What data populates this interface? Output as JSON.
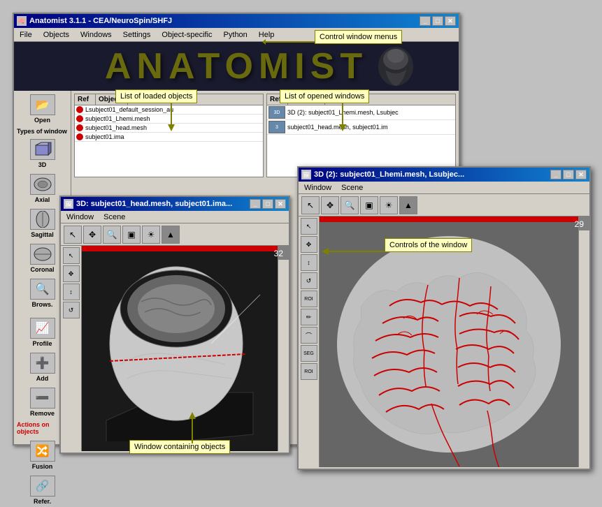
{
  "main_window": {
    "title": "Anatomist 3.1.1 - CEA/NeuroSpin/SHFJ",
    "menu_items": [
      "File",
      "Objects",
      "Windows",
      "Settings",
      "Object-specific",
      "Python",
      "Help"
    ],
    "logo_text": "ANATOMIST",
    "win_buttons": [
      "_",
      "□",
      "✕"
    ]
  },
  "sidebar": {
    "open_label": "Open",
    "types_label": "Types of window",
    "btn_3d": "3D",
    "btn_axial": "Axial",
    "btn_sagittal": "Sagittal",
    "btn_coronal": "Coronal",
    "btn_browse": "Brows.",
    "btn_profile": "Profile",
    "btn_add": "Add",
    "btn_remove": "Remove",
    "actions_label": "Actions on objects",
    "btn_fusion": "Fusion",
    "btn_refer": "Refer."
  },
  "objects_panel": {
    "header_ref": "Ref",
    "header_objects": "Objects",
    "rows": [
      {
        "text": "Lsubject01_default_session_au"
      },
      {
        "text": "subject01_Lhemi.mesh"
      },
      {
        "text": "subject01_head.mesh"
      },
      {
        "text": "subject01.ima"
      }
    ]
  },
  "windows_panel": {
    "header_ref": "Ref",
    "header_windows": "Windows",
    "rows": [
      {
        "label": "3D",
        "text": "3D (2): subject01_Lhemi.mesh, Lsubjec"
      },
      {
        "label": "3",
        "text": "subject01_head.mesh, subject01.im"
      }
    ]
  },
  "window_3d_small": {
    "title": "3D: subject01_head.mesh, subject01.ima...",
    "menu_items": [
      "Window",
      "Scene"
    ],
    "viewport_number": "32"
  },
  "window_3d_large": {
    "title": "3D (2): subject01_Lhemi.mesh, Lsubjec...",
    "menu_items": [
      "Window",
      "Scene"
    ],
    "viewport_number": "29"
  },
  "annotations": {
    "control_window_menus": "Control window menus",
    "list_loaded_objects": "List of loaded objects",
    "list_opened_windows": "List of opened windows",
    "controls_of_window": "Controls of the window",
    "window_containing_objects": "Window containing objects"
  }
}
